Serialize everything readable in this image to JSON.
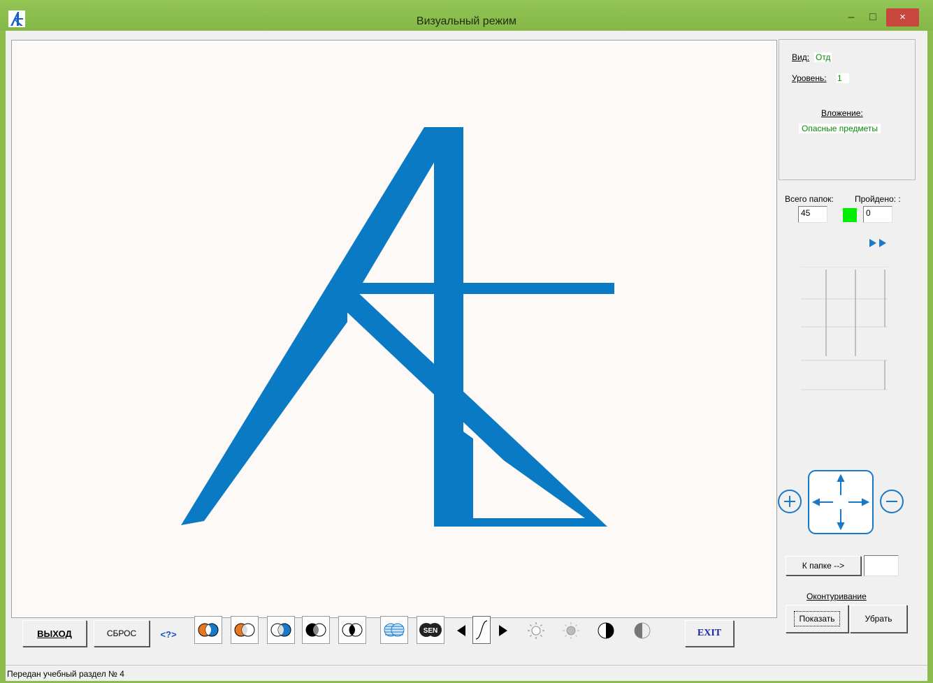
{
  "window": {
    "title": "Визуальный режим",
    "minimize_glyph": "–",
    "maximize_glyph": "□",
    "close_glyph": "×"
  },
  "info": {
    "view_label": "Вид:",
    "view_value": "Отд",
    "level_label": "Уровень:",
    "level_value": "1",
    "attachment_label": "Вложение:",
    "attachment_value": "Опасные предметы"
  },
  "counters": {
    "total_label": "Всего папок:",
    "total_value": "45",
    "passed_label": "Пройдено: :",
    "passed_value": "0"
  },
  "navigation": {
    "to_folder_label": "К папке -->",
    "to_folder_value": ""
  },
  "contour": {
    "label": "Оконтуривание",
    "show_label": "Показать",
    "hide_label": "Убрать"
  },
  "toolbar": {
    "exit_label": "ВЫХОД",
    "reset_label": "СБРОС",
    "help_label": "<?>",
    "exit_en_label": "EXIT",
    "sen_label": "SEN"
  },
  "status": {
    "text": "Передан учебный раздел № 4"
  },
  "colors": {
    "accent_blue": "#0a7ac4",
    "title_green": "#8cbd4e",
    "indicator_green": "#00ee00",
    "value_green": "#0a8a0a",
    "close_red": "#c7463d",
    "orange": "#e87820"
  },
  "icons": {
    "app": "ae-logo-icon",
    "overlay_buttons": [
      "orange-blue-circles-icon",
      "orange-outline-circles-icon",
      "blue-outline-circles-icon",
      "black-white-circles-icon",
      "black-inverted-circles-icon"
    ],
    "filters": [
      "striped-circles-icon",
      "sen-icon"
    ],
    "contrast": [
      "arrow-left-icon",
      "contrast-curve-icon",
      "arrow-right-icon",
      "brightness-up-icon",
      "brightness-down-icon",
      "contrast-up-icon",
      "contrast-down-icon"
    ]
  }
}
